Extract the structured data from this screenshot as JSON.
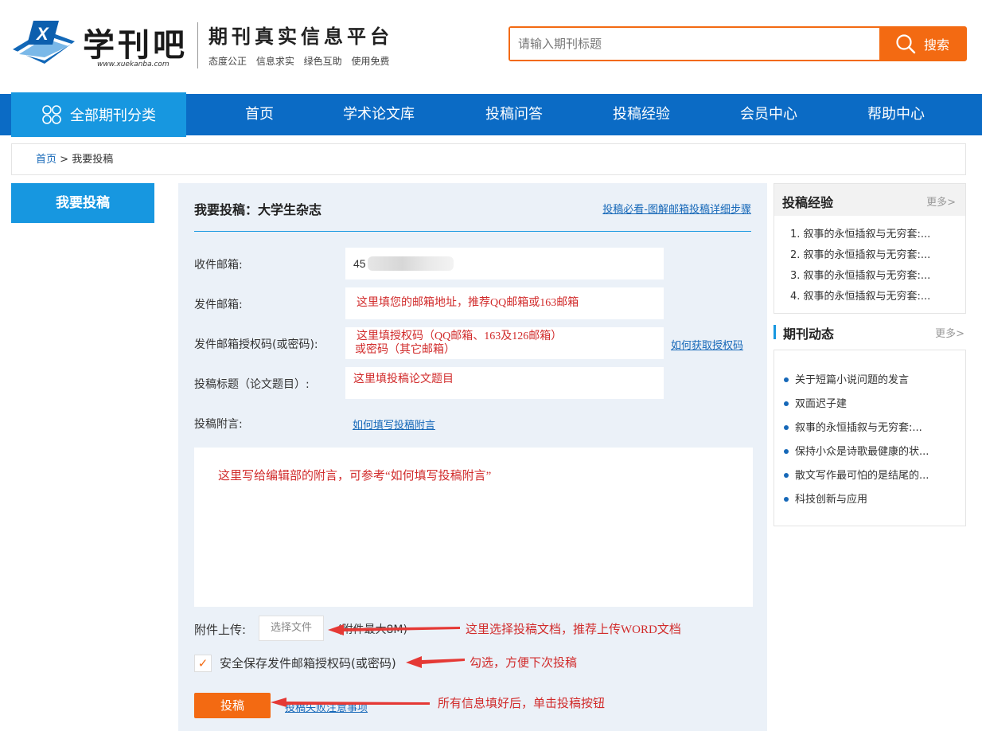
{
  "header": {
    "logo_name": "学刊吧",
    "logo_url": "www.xuekanba.com",
    "slogan": "期刊真实信息平台",
    "tagline": "态度公正 信息求实 绿色互助 使用免费",
    "search_placeholder": "请输入期刊标题",
    "search_button": "搜索"
  },
  "nav": {
    "category": "全部期刊分类",
    "items": [
      "首页",
      "学术论文库",
      "投稿问答",
      "投稿经验",
      "会员中心",
      "帮助中心"
    ]
  },
  "breadcrumb": {
    "home": "首页",
    "separator": ">",
    "current": "我要投稿"
  },
  "sidebar_left": {
    "button": "我要投稿"
  },
  "form": {
    "title": "我要投稿：大学生杂志",
    "guide_link": "投稿必看-图解邮箱投稿详细步骤",
    "recipient_label": "收件邮箱:",
    "recipient_value": "45",
    "sender_label": "发件邮箱:",
    "sender_value": "这里填您的邮箱地址，推荐QQ邮箱或163邮箱",
    "auth_label": "发件邮箱授权码(或密码):",
    "auth_value_line1": "这里填授权码（QQ邮箱、163及126邮箱）",
    "auth_value_line2": "或密码（其它邮箱）",
    "auth_link": "如何获取授权码",
    "subject_label": "投稿标题（论文题目）:",
    "subject_value": "这里填投稿论文题目",
    "note_label": "投稿附言:",
    "note_link": "如何填写投稿附言",
    "note_value": "这里写给编辑部的附言，可参考“如何填写投稿附言”",
    "upload_label": "附件上传:",
    "upload_button": "选择文件",
    "upload_note": "(附件最大8M)",
    "save_checkbox_mark": "✓",
    "save_label": "安全保存发件邮箱授权码(或密码)",
    "submit": "投稿",
    "notice_link": "投稿失败注意事项"
  },
  "annotations": {
    "upload": "这里选择投稿文档，推荐上传WORD文档",
    "checkbox": "勾选，方便下次投稿",
    "submit": "所有信息填好后，单击投稿按钮"
  },
  "sidebar_right": {
    "experience_title": "投稿经验",
    "experience_more": "更多>",
    "experience_items": [
      "1. 叙事的永恒插叙与无穷套:...",
      "2. 叙事的永恒插叙与无穷套:...",
      "3. 叙事的永恒插叙与无穷套:...",
      "4. 叙事的永恒插叙与无穷套:..."
    ],
    "news_title": "期刊动态",
    "news_more": "更多>",
    "news_items": [
      "关于短篇小说问题的发言",
      "双面迟子建",
      "叙事的永恒插叙与无穷套:...",
      "保持小众是诗歌最健康的状...",
      "散文写作最可怕的是结尾的...",
      "科技创新与应用"
    ]
  },
  "colors": {
    "accent_orange": "#f36a12",
    "nav_blue": "#0b6bc5",
    "light_blue": "#1797e0",
    "annotation_red": "#d12b2b"
  }
}
